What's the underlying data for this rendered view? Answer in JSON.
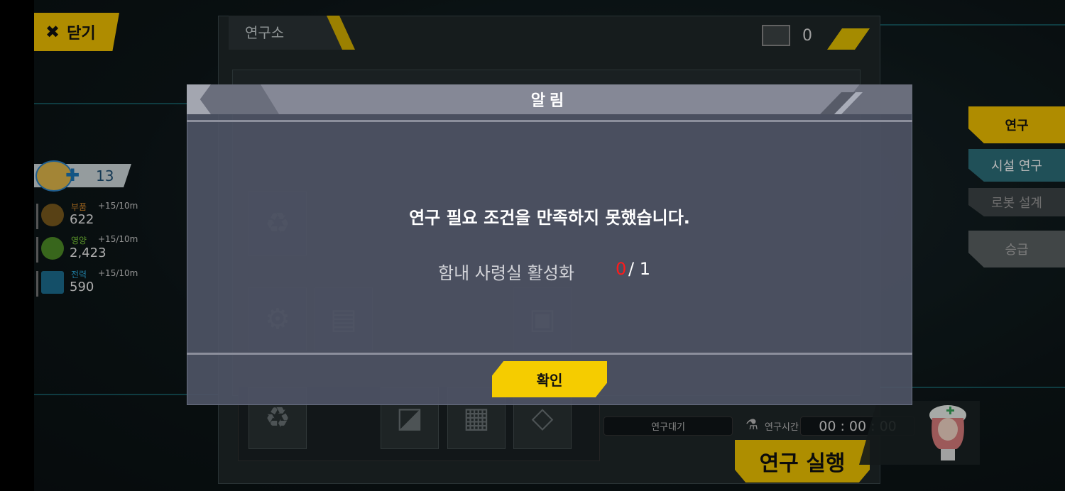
{
  "close": {
    "label": "닫기"
  },
  "lab": {
    "title": "연구소",
    "chip_count": "0"
  },
  "player": {
    "count": "13"
  },
  "resources": [
    {
      "name": "부품",
      "rate": "+15/10m",
      "value": "622",
      "color": "#d88a2a"
    },
    {
      "name": "영양",
      "rate": "+15/10m",
      "value": "2,423",
      "color": "#7ccd3a"
    },
    {
      "name": "전력",
      "rate": "+15/10m",
      "value": "590",
      "color": "#2aa7d8"
    }
  ],
  "menu": {
    "research": "연구",
    "facility": "시설 연구",
    "robot": "로봇 설계",
    "promote": "승급"
  },
  "research": {
    "status": "연구대기",
    "time_label": "연구시간",
    "time": "00 : 00 : 00",
    "run": "연구 실행"
  },
  "modal": {
    "title": "알림",
    "message": "연구 필요 조건을 만족하지 못했습니다.",
    "condition_label": "함내 사령실 활성화",
    "condition_current": "0",
    "condition_rest": "/ 1",
    "confirm": "확인"
  },
  "colors": {
    "accent": "#f3c300",
    "error": "#ff1a1a"
  }
}
